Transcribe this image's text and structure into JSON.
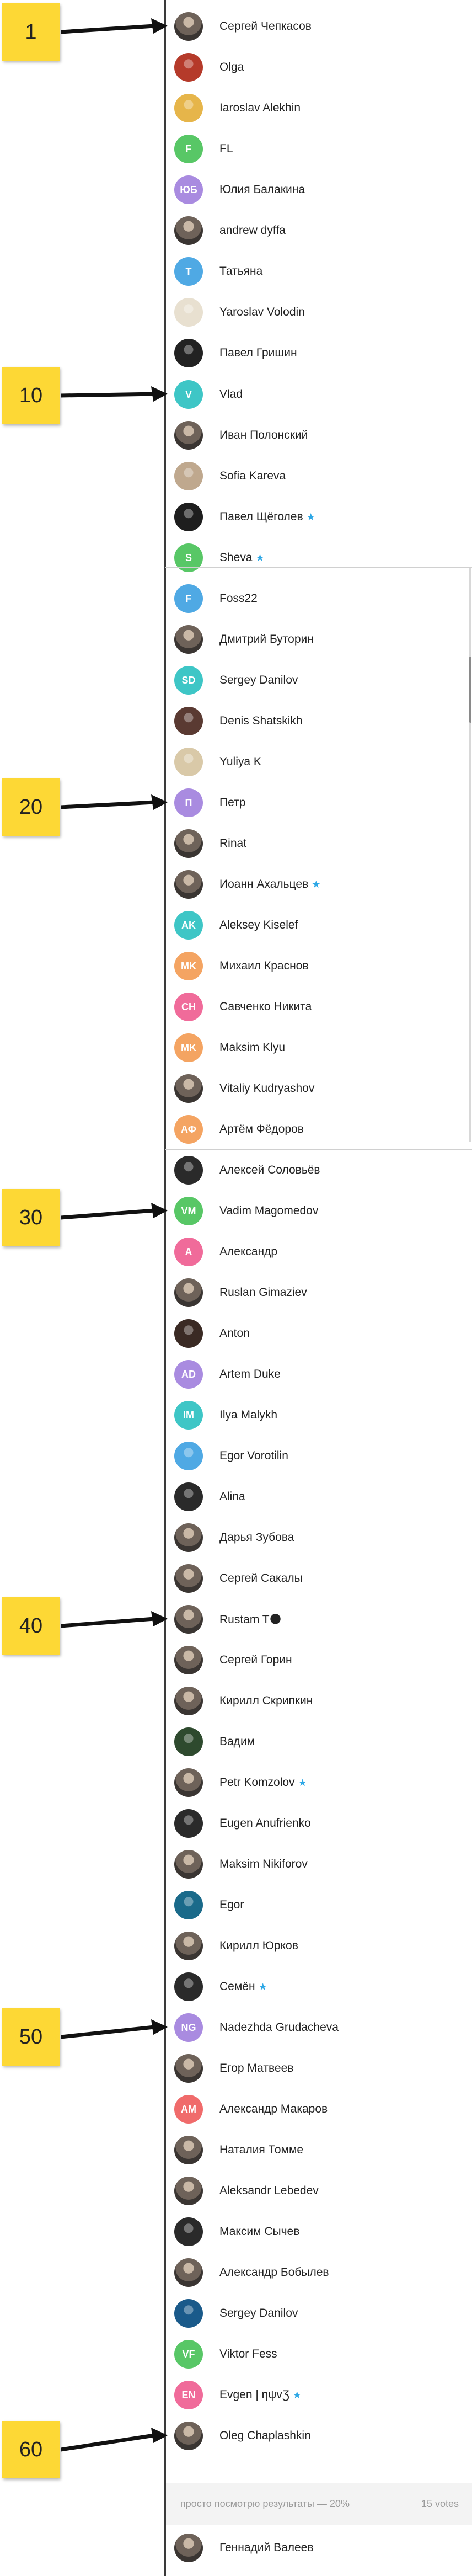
{
  "voters": [
    {
      "name": "Сергей Чепкасов",
      "initials": "",
      "color": ""
    },
    {
      "name": "Olga",
      "initials": "",
      "color": "#b53a2a"
    },
    {
      "name": "Iaroslav Alekhin",
      "initials": "",
      "color": "#e6b54a"
    },
    {
      "name": "FL",
      "initials": "F",
      "color": "#58c766"
    },
    {
      "name": "Юлия Балакина",
      "initials": "ЮБ",
      "color": "#a98be0"
    },
    {
      "name": "andrew dyffa",
      "initials": "",
      "color": ""
    },
    {
      "name": "Татьяна",
      "initials": "T",
      "color": "#4fa9e4"
    },
    {
      "name": "Yaroslav Volodin",
      "initials": "",
      "color": "#e8e0d0"
    },
    {
      "name": "Павел Гришин",
      "initials": "",
      "color": "#222222"
    },
    {
      "name": "Vlad",
      "initials": "V",
      "color": "#3ec6c6"
    },
    {
      "name": "Иван Полонский",
      "initials": "",
      "color": ""
    },
    {
      "name": "Sofia Kareva",
      "initials": "",
      "color": "#bfa88e"
    },
    {
      "name": "Павел Щёголев",
      "initials": "",
      "color": "#1e1e1e",
      "star": true
    },
    {
      "name": "Sheva",
      "initials": "S",
      "color": "#58c766",
      "star": true
    },
    {
      "name": "Foss22",
      "initials": "F",
      "color": "#4fa9e4"
    },
    {
      "name": "Дмитрий Буторин",
      "initials": "",
      "color": ""
    },
    {
      "name": "Sergey Danilov",
      "initials": "SD",
      "color": "#3ec6c6"
    },
    {
      "name": "Denis Shatskikh",
      "initials": "",
      "color": "#5a3a32"
    },
    {
      "name": "Yuliya K",
      "initials": "",
      "color": "#d9c9a8"
    },
    {
      "name": "Петр",
      "initials": "П",
      "color": "#a98be0"
    },
    {
      "name": "Rinat",
      "initials": "",
      "color": ""
    },
    {
      "name": "Иоанн Ахальцев",
      "initials": "",
      "color": "",
      "star": true
    },
    {
      "name": "Aleksey Kiselef",
      "initials": "AK",
      "color": "#3ec6c6"
    },
    {
      "name": "Михаил Краснов",
      "initials": "MK",
      "color": "#f4a462"
    },
    {
      "name": "Савченко Никита",
      "initials": "CH",
      "color": "#f06b9a"
    },
    {
      "name": "Maksim Klyu",
      "initials": "MK",
      "color": "#f4a462"
    },
    {
      "name": "Vitaliy Kudryashov",
      "initials": "",
      "color": ""
    },
    {
      "name": "Артём Фёдоров",
      "initials": "АФ",
      "color": "#f4a462"
    },
    {
      "name": "Алексей Соловьёв",
      "initials": "",
      "color": "#2a2a2a"
    },
    {
      "name": "Vadim Magomedov",
      "initials": "VM",
      "color": "#58c766"
    },
    {
      "name": "Александр",
      "initials": "A",
      "color": "#f06b9a"
    },
    {
      "name": "Ruslan Gimaziev",
      "initials": "",
      "color": ""
    },
    {
      "name": "Anton",
      "initials": "",
      "color": "#3a2a24"
    },
    {
      "name": "Artem Duke",
      "initials": "AD",
      "color": "#a98be0"
    },
    {
      "name": "Ilya Malykh",
      "initials": "IM",
      "color": "#3ec6c6"
    },
    {
      "name": "Egor Vorotilin",
      "initials": "",
      "color": "#4fa9e4"
    },
    {
      "name": "Alina",
      "initials": "",
      "color": "#2a2a2a"
    },
    {
      "name": "Дарья Зубова",
      "initials": "",
      "color": ""
    },
    {
      "name": "Сергей Сакалы",
      "initials": "",
      "color": ""
    },
    {
      "name": "Rustam T🌑",
      "initials": "",
      "color": ""
    },
    {
      "name": "Сергей Горин",
      "initials": "",
      "color": ""
    },
    {
      "name": "Кирилл Скрипкин",
      "initials": "",
      "color": ""
    },
    {
      "name": "Вадим",
      "initials": "",
      "color": "#2e4a2e"
    },
    {
      "name": "Petr Komzolov",
      "initials": "",
      "color": "",
      "star": true
    },
    {
      "name": "Eugen Anufrienko",
      "initials": "",
      "color": "#2a2a2a"
    },
    {
      "name": "Maksim Nikiforov",
      "initials": "",
      "color": ""
    },
    {
      "name": "Egor",
      "initials": "",
      "color": "#1a6a8a"
    },
    {
      "name": "Кирилл Юрков",
      "initials": "",
      "color": ""
    },
    {
      "name": "Семён",
      "initials": "",
      "color": "#2a2a2a",
      "star": true
    },
    {
      "name": "Nadezhda Grudacheva",
      "initials": "NG",
      "color": "#a98be0"
    },
    {
      "name": "Егор Матвеев",
      "initials": "",
      "color": ""
    },
    {
      "name": "Александр Макаров",
      "initials": "AM",
      "color": "#f06b6b"
    },
    {
      "name": "Наталия Томме",
      "initials": "",
      "color": ""
    },
    {
      "name": "Aleksandr Lebedev",
      "initials": "",
      "color": ""
    },
    {
      "name": "Максим Сычев",
      "initials": "",
      "color": "#2a2a2a"
    },
    {
      "name": "Александр Бобылев",
      "initials": "",
      "color": ""
    },
    {
      "name": "Sergey Danilov",
      "initials": "",
      "color": "#1a5a8a"
    },
    {
      "name": "Viktor Fess",
      "initials": "VF",
      "color": "#58c766"
    },
    {
      "name": "Evgen | ηψvƷ",
      "initials": "EN",
      "color": "#f06b9a",
      "star": true
    },
    {
      "name": "Oleg Chaplashkin",
      "initials": "",
      "color": ""
    },
    {
      "name": "Геннадий Валеев",
      "initials": "",
      "color": ""
    }
  ],
  "markers": [
    {
      "label": "1"
    },
    {
      "label": "10"
    },
    {
      "label": "20"
    },
    {
      "label": "30"
    },
    {
      "label": "40"
    },
    {
      "label": "50"
    },
    {
      "label": "60"
    }
  ],
  "footer": {
    "result_text": "просто посмотрю результаты — 20%",
    "votes": "15 votes"
  },
  "colors": {
    "sticky": "#fdd835",
    "star": "#2ea8e6",
    "divider": "#3a3a3a",
    "footer_bg": "#f3f3f3"
  }
}
